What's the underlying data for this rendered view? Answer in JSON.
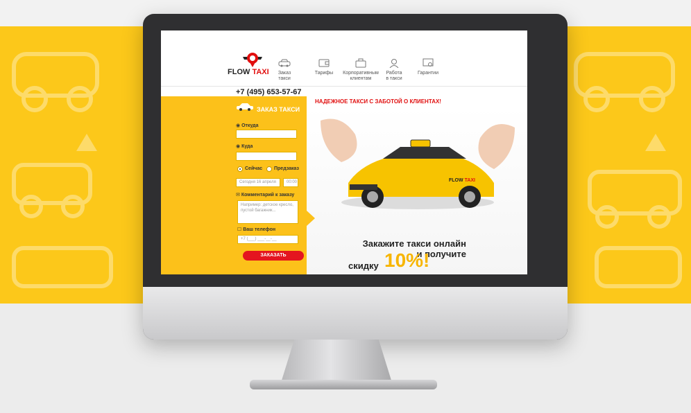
{
  "brand": {
    "logo_prefix": "FLOW",
    "logo_suffix": "TAXI"
  },
  "nav": [
    {
      "label": "Заказ такси",
      "icon": "car-icon"
    },
    {
      "label": "Тарифы",
      "icon": "wallet-icon"
    },
    {
      "label": "Корпоративным клиентам",
      "icon": "briefcase-icon"
    },
    {
      "label": "Работа в такси",
      "icon": "driver-icon"
    },
    {
      "label": "Гарантии",
      "icon": "certificate-icon"
    }
  ],
  "phone": "+7 (495) 653-57-67",
  "slogan": "НАДЕЖНОЕ ТАКСИ С ЗАБОТОЙ О КЛИЕНТАХ!",
  "form": {
    "title": "ЗАКАЗ ТАКСИ",
    "from_label": "Откуда",
    "to_label": "Куда",
    "now_label": "Сейчас",
    "preorder_label": "Предзаказ",
    "date_value": "Сегодня 16 апреля",
    "time_value": "00:00",
    "comment_label": "Комментарий к заказу",
    "comment_placeholder": "Например: детское кресло, пустой багажник...",
    "phone_label": "Ваш телефон",
    "phone_placeholder": "+7 (___) ___-__-__",
    "submit": "ЗАКАЗАТЬ",
    "selected_time_mode": "Сейчас"
  },
  "hero": {
    "line1": "Закажите такси онлайн",
    "line2": "и получите",
    "line3": "скидку",
    "discount": "10%!",
    "car_logo_prefix": "FLOW",
    "car_logo_suffix": "TAXI"
  },
  "colors": {
    "accent": "#fcc11a",
    "red": "#e4151f"
  }
}
